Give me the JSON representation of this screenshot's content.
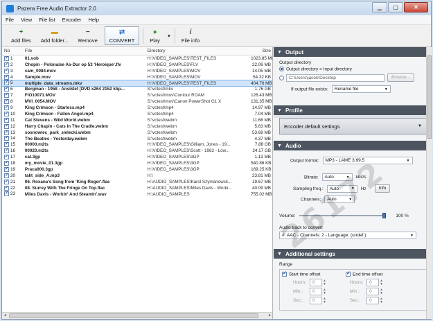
{
  "window": {
    "title": "Pazera Free Audio Extractor 2.0"
  },
  "menu": [
    "File",
    "View",
    "File list",
    "Encoder",
    "Help"
  ],
  "toolbar": {
    "add_files": "Add files",
    "add_folder": "Add folder...",
    "remove": "Remove",
    "convert": "CONVERT",
    "play": "Play",
    "file_info": "File info"
  },
  "filelist": {
    "columns": [
      "No",
      "File",
      "Directory",
      "Size"
    ],
    "rows": [
      {
        "no": "1",
        "file": "01.vob",
        "dir": "H:\\VIDEO_SAMPLES\\TEST_FILES",
        "size": "1023.85 MB"
      },
      {
        "no": "2",
        "file": "Chopin - Polonaise As-Dur op 53 'Heroique'.flv",
        "dir": "H:\\VIDEO_SAMPLES\\FLV",
        "size": "22.06 MB"
      },
      {
        "no": "3",
        "file": "cam_0084.mov",
        "dir": "H:\\VIDEO_SAMPLES\\MOV",
        "size": "14.05 MB"
      },
      {
        "no": "4",
        "file": "Sample.mov",
        "dir": "H:\\VIDEO_SAMPLES\\MOV",
        "size": "54.32 KB"
      },
      {
        "no": "5",
        "file": "multiple_data_streams.mkv",
        "dir": "H:\\VIDEO_SAMPLES\\TEST_FILES",
        "size": "404.76 MB"
      },
      {
        "no": "6",
        "file": "Bergman - 1958 - Ansiktet [DVD x264 2152 kbp...",
        "dir": "S:\\vctest\\mkv",
        "size": "1.76 GB"
      },
      {
        "no": "7",
        "file": "FIO10071.MOV",
        "dir": "S:\\vctest\\mov\\Contour ROAM",
        "size": "126.43 MB"
      },
      {
        "no": "8",
        "file": "MVI_0054.MOV",
        "dir": "S:\\vctest\\mov\\Canon PowerShot G1 X",
        "size": "131.35 MB"
      },
      {
        "no": "9",
        "file": "King Crimson - Starless.mp4",
        "dir": "S:\\vctest\\mp4",
        "size": "14.97 MB"
      },
      {
        "no": "10",
        "file": "King Crimson - Fallen Angel.mp4",
        "dir": "S:\\vctest\\mp4",
        "size": "7.04 MB"
      },
      {
        "no": "11",
        "file": "Cat Stevens - Wild World.webm",
        "dir": "S:\\vctest\\webm",
        "size": "11.68 MB"
      },
      {
        "no": "12",
        "file": "Harry Chapin - Cats In The Cradle.webm",
        "dir": "S:\\vctest\\webm",
        "size": "5.63 MB"
      },
      {
        "no": "13",
        "file": "sosnowiec_park_sielecki.webm",
        "dir": "S:\\vctest\\webm",
        "size": "53.68 MB"
      },
      {
        "no": "14",
        "file": "The Beatles - Yesterday.webm",
        "dir": "S:\\vctest\\webm",
        "size": "4.37 MB"
      },
      {
        "no": "15",
        "file": "00000.m2ts",
        "dir": "H:\\VIDEO_SAMPLES\\Gilliam, Jones - 19...",
        "size": "7.88 GB"
      },
      {
        "no": "16",
        "file": "00020.m2ts",
        "dir": "H:\\VIDEO_SAMPLES\\Scott - 1982 - Low...",
        "size": "24.17 GB"
      },
      {
        "no": "17",
        "file": "cat.3gp",
        "dir": "H:\\VIDEO_SAMPLES\\3GP",
        "size": "1.13 MB"
      },
      {
        "no": "18",
        "file": "my_movie_01.3gp",
        "dir": "H:\\VIDEO_SAMPLES\\3GP",
        "size": "540.86 KB"
      },
      {
        "no": "19",
        "file": "Praca000.3gp",
        "dir": "H:\\VIDEO_SAMPLES\\3GP",
        "size": "169.25 KB"
      },
      {
        "no": "20",
        "file": "takt_side_A.mp3",
        "dir": "H:\\",
        "size": "23.81 MB"
      },
      {
        "no": "21",
        "file": "06. Roxana's Song from 'King Roger'.flac",
        "dir": "H:\\AUDIO_SAMPLES\\Karol Szymanowsk...",
        "size": "19.67 MB"
      },
      {
        "no": "22",
        "file": "08. Surrey With The Fringe On Top.flac",
        "dir": "H:\\AUDIO_SAMPLES\\Miles Davis - Worki...",
        "size": "40.09 MB"
      },
      {
        "no": "23",
        "file": "Miles Davis - Workin' And Steamin'.wav",
        "dir": "H:\\AUDIO_SAMPLES",
        "size": "755.02 MB"
      }
    ],
    "selected_row": "5"
  },
  "output": {
    "header": "Output",
    "dir_label": "Output directory",
    "opt_input": "Output directory = Input directory",
    "path_placeholder": "C:\\Users\\jacek\\Desktop",
    "browse": "Browse...",
    "exists_label": "If output file exists:",
    "exists_value": "Rename file"
  },
  "profile": {
    "header": "Profile",
    "value": "Encoder default settings"
  },
  "audio": {
    "header": "Audio",
    "format_label": "Output format:",
    "format_value": "MP3 - LAME 3.99.5",
    "bitrate_label": "Bitrate:",
    "bitrate_value": "Auto",
    "bitrate_unit": "kbit/s",
    "sampling_label": "Sampling freq.:",
    "sampling_value": "Auto",
    "sampling_unit": "Hz",
    "info": "Info",
    "channels_label": "Channels:",
    "channels_value": "Auto",
    "volume_label": "Volume:",
    "volume_value": "100 %",
    "volume_level": 1.0,
    "track_label": "Audio track to convert",
    "track_value": "#: AAC - Channels: 2 - Language: (undef.)"
  },
  "additional": {
    "header": "Additional settings",
    "range_label": "Range",
    "start_label": "Start time offset",
    "end_label": "End time offset",
    "hours": "Hours:",
    "min": "Min.:",
    "sec": "Sec.:",
    "zero": "0"
  },
  "watermark": "26172"
}
